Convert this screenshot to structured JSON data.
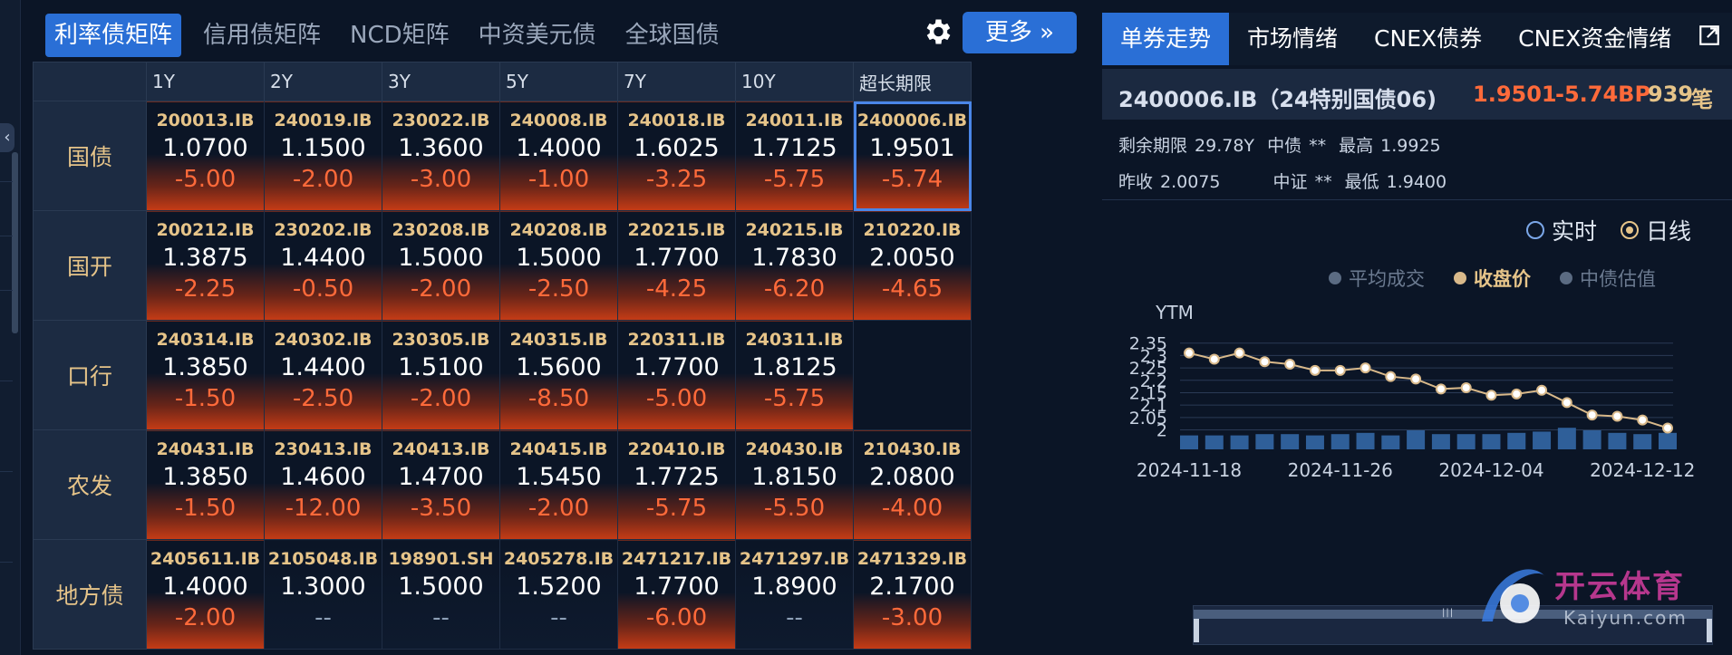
{
  "left": {
    "tabs": [
      "利率债矩阵",
      "信用债矩阵",
      "NCD矩阵",
      "中资美元债",
      "全球国债"
    ],
    "more_label": "更多 »",
    "columns": [
      "1Y",
      "2Y",
      "3Y",
      "5Y",
      "7Y",
      "10Y",
      "超长期限"
    ],
    "rows": [
      {
        "label": "国债",
        "cells": [
          {
            "code": "200013.IB",
            "yield": "1.0700",
            "chg": "-5.00"
          },
          {
            "code": "240019.IB",
            "yield": "1.1500",
            "chg": "-2.00"
          },
          {
            "code": "230022.IB",
            "yield": "1.3600",
            "chg": "-3.00"
          },
          {
            "code": "240008.IB",
            "yield": "1.4000",
            "chg": "-1.00"
          },
          {
            "code": "240018.IB",
            "yield": "1.6025",
            "chg": "-3.25"
          },
          {
            "code": "240011.IB",
            "yield": "1.7125",
            "chg": "-5.75"
          },
          {
            "code": "2400006.IB",
            "yield": "1.9501",
            "chg": "-5.74"
          }
        ]
      },
      {
        "label": "国开",
        "cells": [
          {
            "code": "200212.IB",
            "yield": "1.3875",
            "chg": "-2.25"
          },
          {
            "code": "230202.IB",
            "yield": "1.4400",
            "chg": "-0.50"
          },
          {
            "code": "230208.IB",
            "yield": "1.5000",
            "chg": "-2.00"
          },
          {
            "code": "240208.IB",
            "yield": "1.5000",
            "chg": "-2.50"
          },
          {
            "code": "220215.IB",
            "yield": "1.7700",
            "chg": "-4.25"
          },
          {
            "code": "240215.IB",
            "yield": "1.7830",
            "chg": "-6.20"
          },
          {
            "code": "210220.IB",
            "yield": "2.0050",
            "chg": "-4.65"
          }
        ]
      },
      {
        "label": "口行",
        "cells": [
          {
            "code": "240314.IB",
            "yield": "1.3850",
            "chg": "-1.50"
          },
          {
            "code": "240302.IB",
            "yield": "1.4400",
            "chg": "-2.50"
          },
          {
            "code": "230305.IB",
            "yield": "1.5100",
            "chg": "-2.00"
          },
          {
            "code": "240315.IB",
            "yield": "1.5600",
            "chg": "-8.50"
          },
          {
            "code": "220311.IB",
            "yield": "1.7700",
            "chg": "-5.00"
          },
          {
            "code": "240311.IB",
            "yield": "1.8125",
            "chg": "-5.75"
          },
          null
        ]
      },
      {
        "label": "农发",
        "cells": [
          {
            "code": "240431.IB",
            "yield": "1.3850",
            "chg": "-1.50"
          },
          {
            "code": "230413.IB",
            "yield": "1.4600",
            "chg": "-12.00"
          },
          {
            "code": "240413.IB",
            "yield": "1.4700",
            "chg": "-3.50"
          },
          {
            "code": "240415.IB",
            "yield": "1.5450",
            "chg": "-2.00"
          },
          {
            "code": "220410.IB",
            "yield": "1.7725",
            "chg": "-5.75"
          },
          {
            "code": "240430.IB",
            "yield": "1.8150",
            "chg": "-5.50"
          },
          {
            "code": "210430.IB",
            "yield": "2.0800",
            "chg": "-4.00"
          }
        ]
      },
      {
        "label": "地方债",
        "cells": [
          {
            "code": "2405611.IB",
            "yield": "1.4000",
            "chg": "-2.00"
          },
          {
            "code": "2105048.IB",
            "yield": "1.3000",
            "chg": "--"
          },
          {
            "code": "198901.SH",
            "yield": "1.5000",
            "chg": "--"
          },
          {
            "code": "2405278.IB",
            "yield": "1.5200",
            "chg": "--"
          },
          {
            "code": "2471217.IB",
            "yield": "1.7700",
            "chg": "-6.00"
          },
          {
            "code": "2471297.IB",
            "yield": "1.8900",
            "chg": "--"
          },
          {
            "code": "2471329.IB",
            "yield": "2.1700",
            "chg": "-3.00"
          }
        ]
      }
    ],
    "selected_cell": {
      "row": 0,
      "col": 6
    }
  },
  "right": {
    "tabs": [
      "单券走势",
      "市场情绪",
      "CNEX债券",
      "CNEX资金情绪"
    ],
    "bond": {
      "name": "2400006.IB（24特别国债06)",
      "yield": "1.9501",
      "change": "-5.74BP",
      "volume": "939",
      "volume_unit": "笔"
    },
    "info1": {
      "remaining_label": "剩余期限",
      "remaining": "29.78Y",
      "cb_label": "中债",
      "cb_value": "**",
      "high_label": "最高",
      "high": "1.9925"
    },
    "info2": {
      "prev_label": "昨收",
      "prev": "2.0075",
      "cs_label": "中证",
      "cs_value": "**",
      "low_label": "最低",
      "low": "1.9400"
    },
    "radios": [
      "实时",
      "日线"
    ],
    "radio_selected": "日线",
    "legend": [
      "平均成交",
      "收盘价",
      "中债估值"
    ],
    "legend_active": "收盘价"
  },
  "watermark": {
    "cn": "开云体育",
    "en": "Kaiyun.com"
  },
  "colors": {
    "accent": "#2a6fd6",
    "down": "#ff6a3a",
    "gold": "#e6c489",
    "bg": "#0b1526"
  },
  "chart_data": {
    "type": "line",
    "ylabel": "YTM",
    "x": [
      "2024-11-18",
      "2024-11-19",
      "2024-11-20",
      "2024-11-21",
      "2024-11-22",
      "2024-11-25",
      "2024-11-26",
      "2024-11-27",
      "2024-11-28",
      "2024-11-29",
      "2024-12-02",
      "2024-12-03",
      "2024-12-04",
      "2024-12-05",
      "2024-12-06",
      "2024-12-09",
      "2024-12-10",
      "2024-12-11",
      "2024-12-12",
      "2024-12-13"
    ],
    "xticks": [
      "2024-11-18",
      "2024-11-26",
      "2024-12-04",
      "2024-12-12"
    ],
    "yticks": [
      2,
      2.05,
      2.1,
      2.15,
      2.2,
      2.25,
      2.3,
      2.35
    ],
    "ylim": [
      1.98,
      2.36
    ],
    "series": [
      {
        "name": "收盘价",
        "values": [
          2.31,
          2.285,
          2.31,
          2.275,
          2.265,
          2.24,
          2.24,
          2.25,
          2.215,
          2.205,
          2.165,
          2.17,
          2.14,
          2.145,
          2.16,
          2.11,
          2.06,
          2.055,
          2.04,
          2.0075
        ]
      }
    ],
    "volume": [
      0.55,
      0.55,
      0.55,
      0.6,
      0.6,
      0.55,
      0.6,
      0.65,
      0.55,
      0.75,
      0.6,
      0.6,
      0.6,
      0.65,
      0.7,
      0.85,
      0.75,
      0.65,
      0.6,
      0.65
    ],
    "legend_position": "top-right",
    "grid": true
  }
}
